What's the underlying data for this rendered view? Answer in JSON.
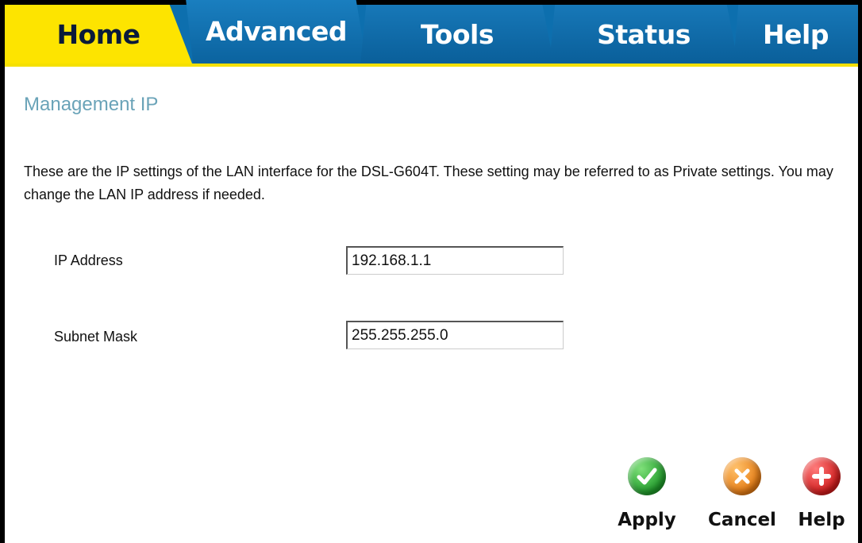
{
  "tabs": {
    "home": "Home",
    "advanced": "Advanced",
    "tools": "Tools",
    "status": "Status",
    "help": "Help"
  },
  "page": {
    "title": "Management IP",
    "description": "These are the IP settings of the LAN interface for the DSL-G604T. These setting may be referred to as Private settings. You may change the LAN IP address if needed."
  },
  "form": {
    "ip_address_label": "IP Address",
    "ip_address_value": "192.168.1.1",
    "subnet_mask_label": "Subnet Mask",
    "subnet_mask_value": "255.255.255.0"
  },
  "actions": {
    "apply": "Apply",
    "cancel": "Cancel",
    "help": "Help"
  },
  "colors": {
    "active_tab": "#fde400",
    "tab_blue": "#0d6fae",
    "title_color": "#6aa3b8"
  },
  "icons": {
    "apply": "checkmark-icon",
    "cancel": "x-icon",
    "help": "plus-icon"
  }
}
